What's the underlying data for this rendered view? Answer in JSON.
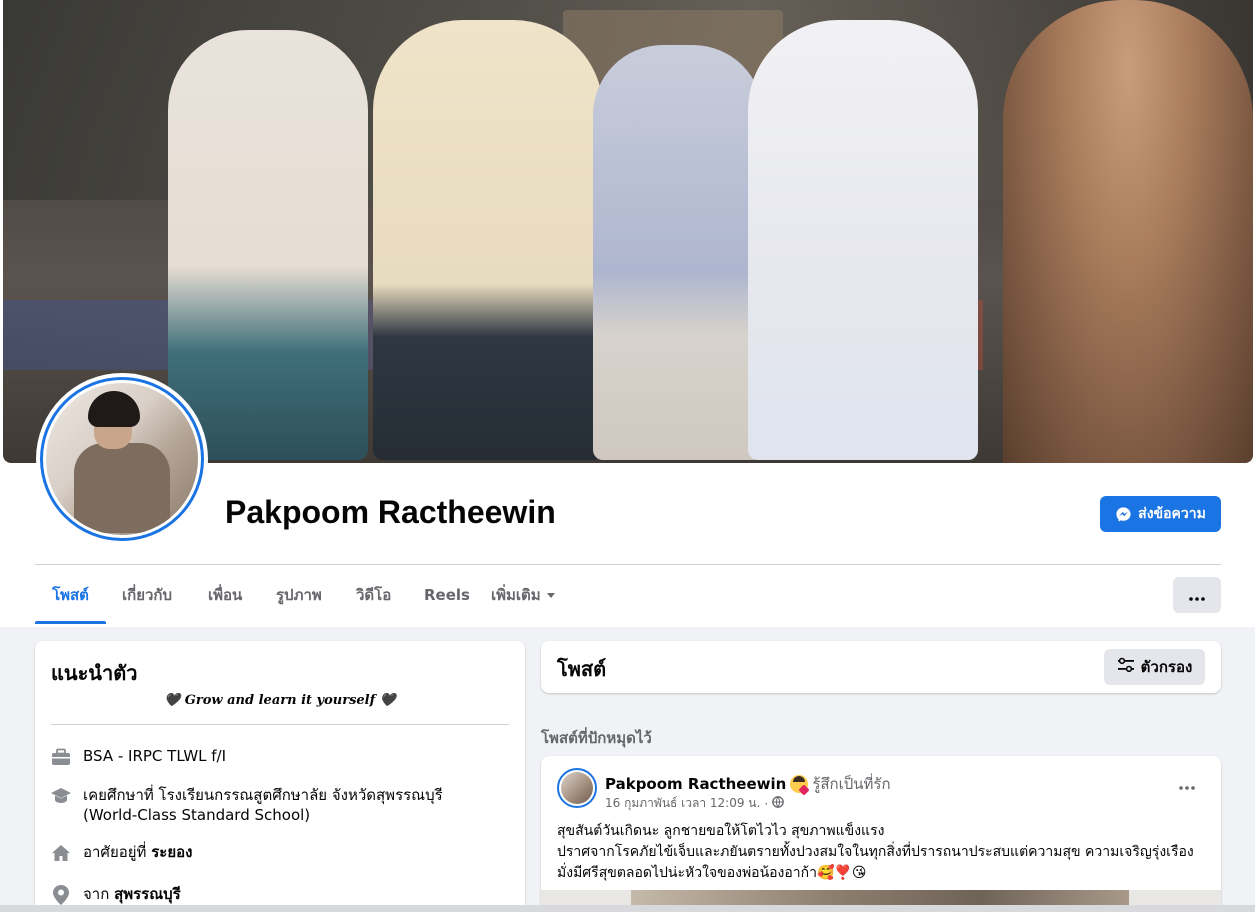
{
  "profile": {
    "name": "Pakpoom Ractheewin",
    "message_button_label": "ส่งข้อความ"
  },
  "tabs": [
    {
      "label": "โพสต์",
      "active": true
    },
    {
      "label": "เกี่ยวกับ",
      "active": false
    },
    {
      "label": "เพื่อน",
      "active": false
    },
    {
      "label": "รูปภาพ",
      "active": false
    },
    {
      "label": "วิดีโอ",
      "active": false
    },
    {
      "label": "Reels",
      "active": false
    },
    {
      "label": "เพิ่มเติม",
      "active": false
    }
  ],
  "intro": {
    "title": "แนะนำตัว",
    "bio": "🖤 Grow and learn it yourself 🖤",
    "work": "BSA - IRPC TLWL f/I",
    "education": "เคยศึกษาที่ โรงเรียนกรรณสูตศึกษาลัย จังหวัดสุพรรณบุรี (World-Class Standard School)",
    "lives_prefix": "อาศัยอยู่ที่",
    "lives_place": "ระยอง",
    "from_prefix": "จาก",
    "from_place": "สุพรรณบุรี"
  },
  "posts_header": {
    "title": "โพสต์",
    "filter_label": "ตัวกรอง"
  },
  "pinned_label": "โพสต์ที่ปักหมุดไว้",
  "post": {
    "author": "Pakpoom Ractheewin",
    "feeling": "รู้สึกเป็นที่รัก",
    "timestamp": "16 กุมภาพันธ์ เวลา 12:09 น.",
    "line1": "สุขสันต์วันเกิดนะ ลูกชายขอให้โตไวไว สุขภาพแข็งแรง",
    "line2": "ปราศจากโรคภัยไข้เจ็บและภยันตรายทั้งปวงสมใจในทุกสิ่งที่ปรารถนาประสบแต่ความสุข ความเจริญรุ่งเรือง",
    "line3": "มั่งมีศรีสุขตลอดไปน่ะหัวใจของพ่อน้องอาก้า🥰❣️😘"
  },
  "colors": {
    "accent": "#1b74e4",
    "background": "#f0f2f5",
    "secondary_text": "#65676b"
  },
  "icons": {
    "messenger": "messenger-icon",
    "more": "more-dots-icon",
    "filter": "filter-sliders-icon",
    "work": "briefcase-icon",
    "education": "graduation-cap-icon",
    "home": "home-icon",
    "location": "location-pin-icon",
    "globe": "globe-icon"
  }
}
